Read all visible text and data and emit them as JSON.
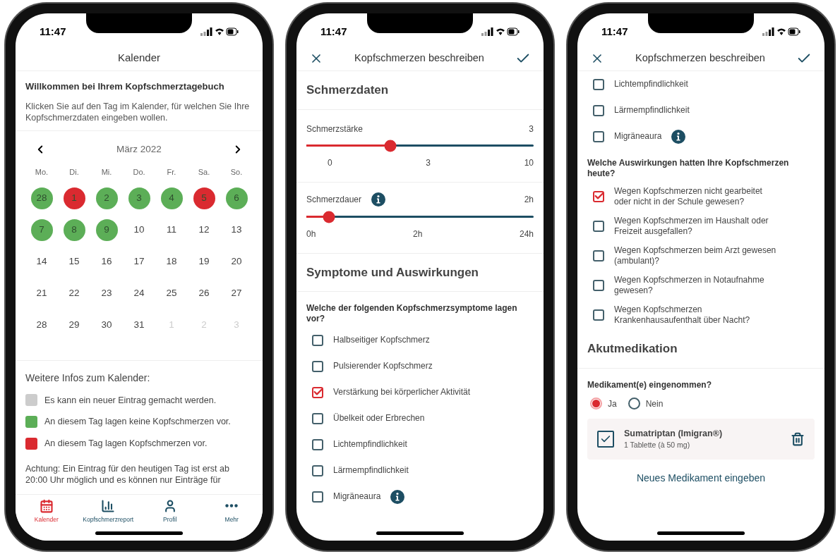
{
  "screens": [
    {
      "kind": "calendar",
      "time": "11:47",
      "title": "Kalender",
      "welcome": {
        "heading": "Willkommen bei Ihrem Kopfschmerztagebuch",
        "text": "Klicken Sie auf den Tag im Kalender, für welchen Sie Ihre Kopfschmerzdaten eingeben wollen."
      },
      "calendar": {
        "month": "März 2022",
        "weekdays": [
          "Mo.",
          "Di.",
          "Mi.",
          "Do.",
          "Fr.",
          "Sa.",
          "So."
        ],
        "days": [
          {
            "label": "28",
            "color": "#5cae57",
            "outside_month": false
          },
          {
            "label": "1",
            "color": "#da2a30",
            "outside_month": false
          },
          {
            "label": "2",
            "color": "#5cae57",
            "outside_month": false
          },
          {
            "label": "3",
            "color": "#5cae57",
            "outside_month": false
          },
          {
            "label": "4",
            "color": "#5cae57",
            "outside_month": false
          },
          {
            "label": "5",
            "color": "#da2a30",
            "outside_month": false
          },
          {
            "label": "6",
            "color": "#5cae57",
            "outside_month": false
          },
          {
            "label": "7",
            "color": "#5cae57",
            "outside_month": false
          },
          {
            "label": "8",
            "color": "#5cae57",
            "outside_month": false
          },
          {
            "label": "9",
            "color": "#5cae57",
            "outside_month": false
          },
          {
            "label": "10",
            "outside_month": false
          },
          {
            "label": "11",
            "outside_month": false
          },
          {
            "label": "12",
            "outside_month": false
          },
          {
            "label": "13",
            "outside_month": false
          },
          {
            "label": "14",
            "outside_month": false
          },
          {
            "label": "15",
            "outside_month": false
          },
          {
            "label": "16",
            "outside_month": false
          },
          {
            "label": "17",
            "outside_month": false
          },
          {
            "label": "18",
            "outside_month": false
          },
          {
            "label": "19",
            "outside_month": false
          },
          {
            "label": "20",
            "outside_month": false
          },
          {
            "label": "21",
            "outside_month": false
          },
          {
            "label": "22",
            "outside_month": false
          },
          {
            "label": "23",
            "outside_month": false
          },
          {
            "label": "24",
            "outside_month": false
          },
          {
            "label": "25",
            "outside_month": false
          },
          {
            "label": "26",
            "outside_month": false
          },
          {
            "label": "27",
            "outside_month": false
          },
          {
            "label": "28",
            "outside_month": false
          },
          {
            "label": "29",
            "outside_month": false
          },
          {
            "label": "30",
            "outside_month": false
          },
          {
            "label": "31",
            "outside_month": false
          },
          {
            "label": "1",
            "outside_month": true
          },
          {
            "label": "2",
            "outside_month": true
          },
          {
            "label": "3",
            "outside_month": true
          }
        ]
      },
      "legend": {
        "title": "Weitere Infos zum Kalender:",
        "items": [
          {
            "color": "#cccccc",
            "text": "Es kann ein neuer Eintrag gemacht werden."
          },
          {
            "color": "#5cae57",
            "text": "An diesem Tag lagen keine Kopfschmerzen vor."
          },
          {
            "color": "#da2a30",
            "text": "An diesem Tag lagen Kopfschmerzen vor."
          }
        ]
      },
      "notice": "Achtung: Ein Eintrag für den heutigen Tag ist erst ab 20:00 Uhr möglich und es können nur Einträge für",
      "tab_bar": [
        {
          "label": "Kalender",
          "selected": true
        },
        {
          "label": "Kopfschmerzreport",
          "selected": false
        },
        {
          "label": "Profil",
          "selected": false
        },
        {
          "label": "Mehr",
          "selected": false
        }
      ]
    },
    {
      "kind": "form",
      "time": "11:47",
      "title": "Kopfschmerzen beschreiben",
      "blocks": [
        {
          "kind": "section",
          "text": "Schmerzdaten"
        },
        {
          "kind": "slider",
          "label": "Schmerzstärke",
          "value": "3",
          "level": 0.37,
          "ticks": [
            "0",
            "3",
            "10"
          ]
        },
        {
          "kind": "slider",
          "label": "Schmerzdauer",
          "value": "2h",
          "info": true,
          "level": 0.1,
          "ticks": [
            "0h",
            "2h",
            "24h"
          ]
        },
        {
          "kind": "section",
          "text": "Symptome und Auswirkungen"
        },
        {
          "kind": "question",
          "text": "Welche der folgenden Kopfschmerzsymptome lagen vor?"
        },
        {
          "kind": "checkbox",
          "text": "Halbseitiger Kopfschmerz",
          "checked": false
        },
        {
          "kind": "checkbox",
          "text": "Pulsierender Kopfschmerz",
          "checked": false
        },
        {
          "kind": "checkbox",
          "text": "Verstärkung bei körperlicher Aktivität",
          "checked": true
        },
        {
          "kind": "checkbox",
          "text": "Übelkeit oder Erbrechen",
          "checked": false
        },
        {
          "kind": "checkbox",
          "text": "Lichtempfindlichkeit",
          "checked": false
        },
        {
          "kind": "checkbox",
          "text": "Lärmempfindlichkeit",
          "checked": false
        },
        {
          "kind": "checkbox",
          "text": "Migräneaura",
          "checked": false,
          "info": true
        }
      ]
    },
    {
      "kind": "form",
      "time": "11:47",
      "title": "Kopfschmerzen beschreiben",
      "blocks": [
        {
          "kind": "checkbox",
          "text": "Lichtempfindlichkeit",
          "checked": false
        },
        {
          "kind": "checkbox",
          "text": "Lärmempfindlichkeit",
          "checked": false
        },
        {
          "kind": "checkbox",
          "text": "Migräneaura",
          "checked": false,
          "info": true
        },
        {
          "kind": "question",
          "text": "Welche Auswirkungen hatten Ihre Kopfschmerzen heute?"
        },
        {
          "kind": "checkbox",
          "text": "Wegen Kopfschmerzen nicht gearbeitet oder nicht in der Schule gewesen?",
          "checked": true
        },
        {
          "kind": "checkbox",
          "text": "Wegen Kopfschmerzen im Haushalt oder Freizeit ausgefallen?",
          "checked": false
        },
        {
          "kind": "checkbox",
          "text": "Wegen Kopfschmerzen beim Arzt gewesen (ambulant)?",
          "checked": false
        },
        {
          "kind": "checkbox",
          "text": "Wegen Kopfschmerzen in Notaufnahme gewesen?",
          "checked": false
        },
        {
          "kind": "checkbox",
          "text": "Wegen Kopfschmerzen Krankenhausaufenthalt über Nacht?",
          "checked": false
        },
        {
          "kind": "section",
          "text": "Akutmedikation"
        },
        {
          "kind": "question",
          "text": "Medikament(e) eingenommen?"
        },
        {
          "kind": "radio",
          "options": [
            {
              "label": "Ja",
              "selected": true
            },
            {
              "label": "Nein",
              "selected": false
            }
          ]
        },
        {
          "kind": "medication",
          "name": "Sumatriptan (Imigran®)",
          "dose": "1 Tablette (à 50 mg)",
          "checked": true
        },
        {
          "kind": "link",
          "text": "Neues Medikament eingeben"
        }
      ]
    }
  ]
}
